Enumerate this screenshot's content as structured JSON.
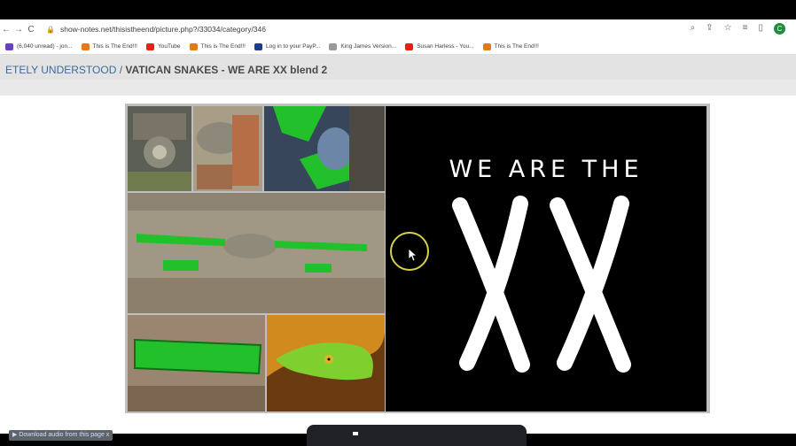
{
  "browser": {
    "url": "show-notes.net/thisistheend/picture.php?/33034/category/346",
    "profile_initial": "C",
    "nav": {
      "back": "←",
      "forward": "→",
      "reload": "C"
    },
    "right_icons": [
      "search-icon",
      "share-icon",
      "star-icon",
      "reading-list-icon",
      "sidepanel-icon"
    ]
  },
  "bookmarks": [
    {
      "label": "(6,040 unread) - jon...",
      "color": "#6a3fc4"
    },
    {
      "label": "This is The End!!!",
      "color": "#e07b1b"
    },
    {
      "label": "YouTube",
      "color": "#e62117"
    },
    {
      "label": "This is The End!!!",
      "color": "#e07b1b"
    },
    {
      "label": "Log in to your PayP...",
      "color": "#1d3c8f"
    },
    {
      "label": "King James Version...",
      "color": "#9a9a9a"
    },
    {
      "label": "Susan Harless - You...",
      "color": "#e62117"
    },
    {
      "label": "This is The End!!!",
      "color": "#e07b1b"
    }
  ],
  "page": {
    "breadcrumb_link": "ETELY UNDERSTOOD",
    "separator": " / ",
    "title": "VATICAN SNAKES - WE ARE XX blend 2"
  },
  "image": {
    "line1": "WE ARE THE",
    "logo": "XX"
  },
  "footer": {
    "download_label": "▶ Download audio from this page",
    "download_suffix": "x"
  },
  "colors": {
    "accent_green": "#22c12c",
    "snake_green": "#7fcf2e"
  }
}
